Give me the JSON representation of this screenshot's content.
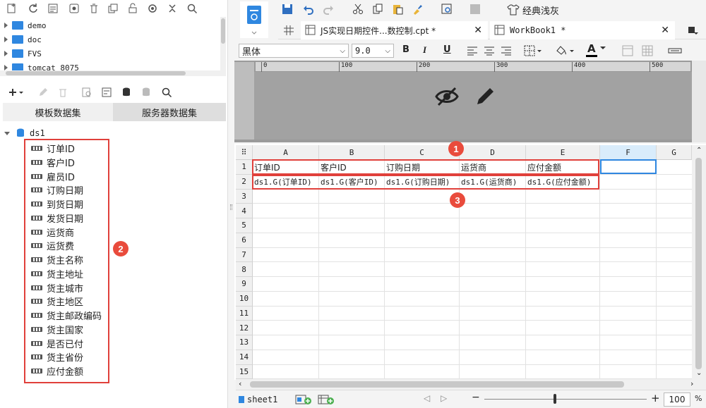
{
  "left": {
    "tree": [
      {
        "label": "demo"
      },
      {
        "label": "doc"
      },
      {
        "label": "FVS"
      },
      {
        "label": "tomcat 8075"
      }
    ],
    "tabs": {
      "template": "模板数据集",
      "server": "服务器数据集"
    },
    "dataset": "ds1",
    "fields": [
      "订单ID",
      "客户ID",
      "雇员ID",
      "订购日期",
      "到货日期",
      "发货日期",
      "运货商",
      "运货费",
      "货主名称",
      "货主地址",
      "货主城市",
      "货主地区",
      "货主邮政编码",
      "货主国家",
      "是否已付",
      "货主省份",
      "应付金额"
    ],
    "badge2": "2"
  },
  "toolbar": {
    "theme_label": "经典浅灰",
    "tab1": "JS实现日期控件...数控制.cpt *",
    "tab2": "WorkBook1 *",
    "font_name": "黑体",
    "font_size": "9.0",
    "bold": "B",
    "italic": "I",
    "underline": "U",
    "font_color_letter": "A"
  },
  "ruler": [
    "0",
    "100",
    "200",
    "300",
    "400",
    "500"
  ],
  "grid": {
    "columns": [
      "A",
      "B",
      "C",
      "D",
      "E",
      "F",
      "G"
    ],
    "rows": [
      "1",
      "2",
      "3",
      "4",
      "5",
      "6",
      "7",
      "8",
      "9",
      "10",
      "11",
      "12",
      "13",
      "14",
      "15"
    ],
    "row1": [
      "订单ID",
      "客户ID",
      "订购日期",
      "运货商",
      "应付金额"
    ],
    "row2": [
      "ds1.G(订单ID)",
      "ds1.G(客户ID)",
      "ds1.G(订购日期)",
      "ds1.G(运货商)",
      "ds1.G(应付金额)"
    ],
    "badge1": "1",
    "badge3": "3"
  },
  "status": {
    "sheet": "sheet1",
    "zoom": "100",
    "zoom_unit": "%",
    "minus": "−",
    "plus": "+"
  },
  "colors": {
    "accent": "#2f87e0",
    "highlight": "#e0403b",
    "badge": "#e94b3c"
  }
}
